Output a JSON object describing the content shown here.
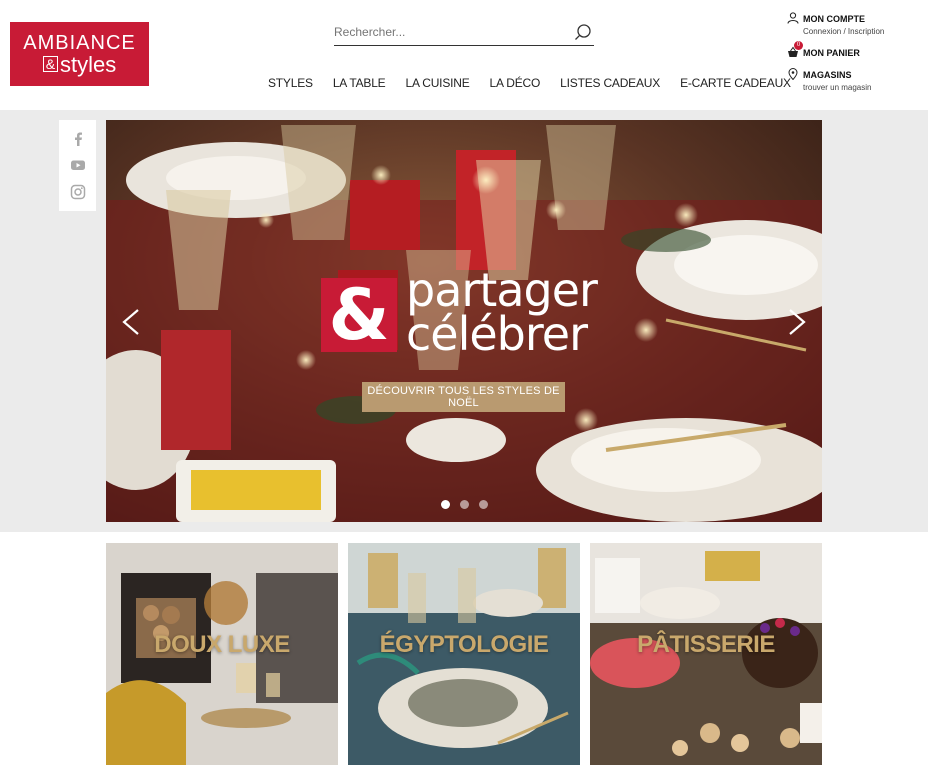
{
  "brand": {
    "line1": "AMBIANCE",
    "amp": "&",
    "line2": "styles",
    "color": "#c81b36"
  },
  "search": {
    "placeholder": "Rechercher..."
  },
  "nav": {
    "items": [
      "STYLES",
      "LA TABLE",
      "LA CUISINE",
      "LA DÉCO",
      "LISTES CADEAUX",
      "E-CARTE CADEAUX"
    ]
  },
  "account": {
    "compte_title": "MON COMPTE",
    "compte_sub": "Connexion / Inscription",
    "panier_title": "MON PANIER",
    "panier_count": "0",
    "magasins_title": "MAGASINS",
    "magasins_sub": "trouver un magasin"
  },
  "social": {
    "icons": [
      "facebook-icon",
      "youtube-icon",
      "instagram-icon"
    ]
  },
  "hero": {
    "amp": "&",
    "line1": "partager",
    "line2": "célébrer",
    "cta": "DÉCOUVRIR TOUS LES STYLES DE NOËL",
    "prev": "<",
    "next": ">",
    "slide_count": 3,
    "active_slide": 1
  },
  "tiles": [
    {
      "label": "DOUX LUXE"
    },
    {
      "label": "ÉGYPTOLOGIE"
    },
    {
      "label": "PÂTISSERIE"
    }
  ],
  "colors": {
    "accent": "#c81b36",
    "gold": "#c9a86c",
    "button": "#b99a70",
    "band": "#ebebeb"
  }
}
